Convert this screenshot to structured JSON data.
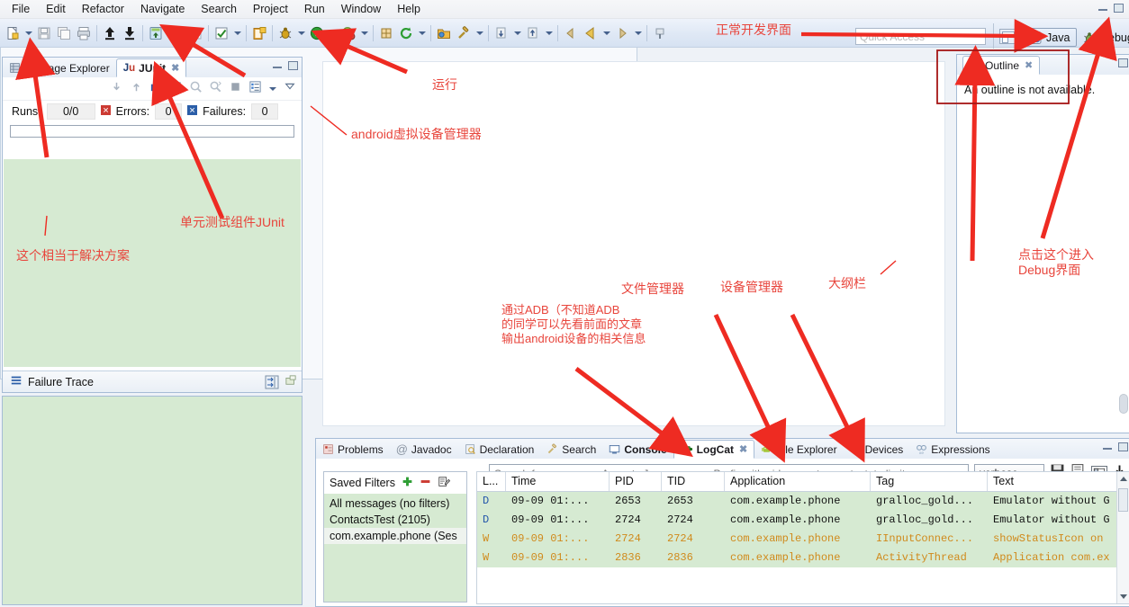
{
  "menu": {
    "items": [
      "File",
      "Edit",
      "Refactor",
      "Navigate",
      "Search",
      "Project",
      "Run",
      "Window",
      "Help"
    ]
  },
  "toolbar": {
    "icons": [
      "new-file-icon",
      "new-dropdown-arrow",
      "save-icon",
      "save-all-icon",
      "print-icon",
      "export-icon",
      "import-icon",
      "download-apk-icon",
      "avd-manager-icon",
      "sdk-manager-icon",
      "check-icon",
      "check-dropdown-arrow",
      "new-android-project-icon",
      "debug-icon",
      "debug-dropdown-arrow",
      "run-icon",
      "run-dropdown-arrow",
      "run-external-icon",
      "run-external-dropdown-arrow",
      "new-class-icon",
      "refresh-icon",
      "refresh-dropdown-arrow",
      "open-folder-icon",
      "search-resource-icon",
      "search-dropdown-arrow",
      "next-annotation-icon",
      "next-dropdown-arrow",
      "prev-annotation-icon",
      "prev-dropdown-arrow",
      "back-icon",
      "back-big-icon",
      "back-dropdown-arrow",
      "forward-icon",
      "forward-dropdown-arrow",
      "pin-editor-icon"
    ]
  },
  "quick_access": {
    "placeholder": "Quick Access"
  },
  "perspectives": {
    "restore_icon": "restore-perspective-icon",
    "items": [
      {
        "label": "Java",
        "icon": "java-perspective-icon",
        "active": true
      },
      {
        "label": "Debug",
        "icon": "debug-perspective-icon",
        "active": false
      }
    ]
  },
  "left_view": {
    "tabs": [
      {
        "label": "Package Explorer",
        "icon": "package-explorer-icon",
        "selected": false,
        "closable": false
      },
      {
        "label": "JUnit",
        "icon": "junit-icon",
        "selected": true,
        "closable": true
      }
    ],
    "window_buttons": [
      "minimize-icon",
      "maximize-icon"
    ],
    "junit_toolbar_icons": [
      "next-failure-icon",
      "prev-failure-icon",
      "show-failures-icon",
      "lock-scroll-icon",
      "rerun-test-icon",
      "rerun-failed-icon",
      "stop-icon",
      "test-history-icon",
      "view-menu-arrow",
      "view-menu-triangle"
    ],
    "counters": {
      "runs_label": "Runs:",
      "runs_value": "0/0",
      "errors_label": "Errors:",
      "errors_value": "0",
      "errors_icon": "error-icon",
      "failures_label": "Failures:",
      "failures_value": "0",
      "failures_icon": "failure-icon"
    }
  },
  "failure_trace": {
    "title": "Failure Trace",
    "icon": "failure-trace-icon",
    "buttons": [
      "compare-results-icon",
      "view-menu-icon"
    ]
  },
  "outline": {
    "tab_label": "Outline",
    "tab_icon": "outline-icon",
    "close_icon": "close-icon",
    "message": "An outline is not available.",
    "window_buttons": [
      "minimize-icon",
      "maximize-icon"
    ]
  },
  "editor_area": {
    "window_buttons": [
      "minimize-icon",
      "maximize-icon"
    ]
  },
  "logcat": {
    "tabs": [
      {
        "label": "Problems",
        "icon": "problems-icon",
        "selected": false
      },
      {
        "label": "Javadoc",
        "icon": "javadoc-icon",
        "selected": false
      },
      {
        "label": "Declaration",
        "icon": "declaration-icon",
        "selected": false
      },
      {
        "label": "Search",
        "icon": "search-icon",
        "selected": false
      },
      {
        "label": "Console",
        "icon": "console-icon",
        "selected": false
      },
      {
        "label": "LogCat",
        "icon": "logcat-icon",
        "selected": true
      },
      {
        "label": "File Explorer",
        "icon": "file-explorer-icon",
        "selected": false
      },
      {
        "label": "Devices",
        "icon": "devices-icon",
        "selected": false
      },
      {
        "label": "Expressions",
        "icon": "expressions-icon",
        "selected": false
      }
    ],
    "window_buttons": [
      "minimize-icon",
      "maximize-icon"
    ],
    "saved_filters": {
      "title": "Saved Filters",
      "add_icon": "add-filter-icon",
      "remove_icon": "remove-filter-icon",
      "edit_icon": "edit-filter-icon",
      "items": [
        {
          "label": "All messages (no filters)",
          "selected": false
        },
        {
          "label": "ContactsTest (2105)",
          "selected": false
        },
        {
          "label": "com.example.phone (Ses",
          "selected": true
        }
      ]
    },
    "search": {
      "placeholder": "Search for messages. Accepts Java regexes. Prefix with pid:, app:, tag: or text: to limit sco"
    },
    "level_select": {
      "value": "verbose"
    },
    "toolbar_icons": [
      "save-log-icon",
      "clear-log-icon",
      "display-view-icon",
      "scroll-lock-icon"
    ],
    "columns": [
      "L...",
      "Time",
      "PID",
      "TID",
      "Application",
      "Tag",
      "Text"
    ],
    "rows": [
      {
        "level": "D",
        "time": "09-09 01:...",
        "pid": "2653",
        "tid": "2653",
        "application": "com.example.phone",
        "tag": "gralloc_gold...",
        "text": "Emulator without G"
      },
      {
        "level": "D",
        "time": "09-09 01:...",
        "pid": "2724",
        "tid": "2724",
        "application": "com.example.phone",
        "tag": "gralloc_gold...",
        "text": "Emulator without G"
      },
      {
        "level": "W",
        "time": "09-09 01:...",
        "pid": "2724",
        "tid": "2724",
        "application": "com.example.phone",
        "tag": "IInputConnec...",
        "text": "showStatusIcon on"
      },
      {
        "level": "W",
        "time": "09-09 01:...",
        "pid": "2836",
        "tid": "2836",
        "application": "com.example.phone",
        "tag": "ActivityThread",
        "text": "Application com.ex"
      }
    ]
  },
  "annotations": [
    {
      "id": "normal-dev-ui",
      "text": "正常开发界面"
    },
    {
      "id": "run",
      "text": "运行"
    },
    {
      "id": "avd-manager",
      "text": "android虚拟设备管理器"
    },
    {
      "id": "junit-component",
      "text": "单元测试组件JUnit"
    },
    {
      "id": "solution-equivalent",
      "text": "这个相当于解决方案"
    },
    {
      "id": "file-manager",
      "text": "文件管理器"
    },
    {
      "id": "device-manager",
      "text": "设备管理器"
    },
    {
      "id": "outline-bar",
      "text": "大纲栏"
    },
    {
      "id": "adb-note",
      "text": "通过ADB（不知道ADB\n的同学可以先看前面的文章\n输出android设备的相关信息"
    },
    {
      "id": "debug-entry",
      "text": "点击这个进入\nDebug界面"
    }
  ],
  "colors": {
    "annotation_red": "#e8453c",
    "highlight_box_red": "#a51616",
    "log_green": "#d6ead2",
    "warn_orange": "#d08a1c",
    "debug_blue": "#2255aa"
  }
}
